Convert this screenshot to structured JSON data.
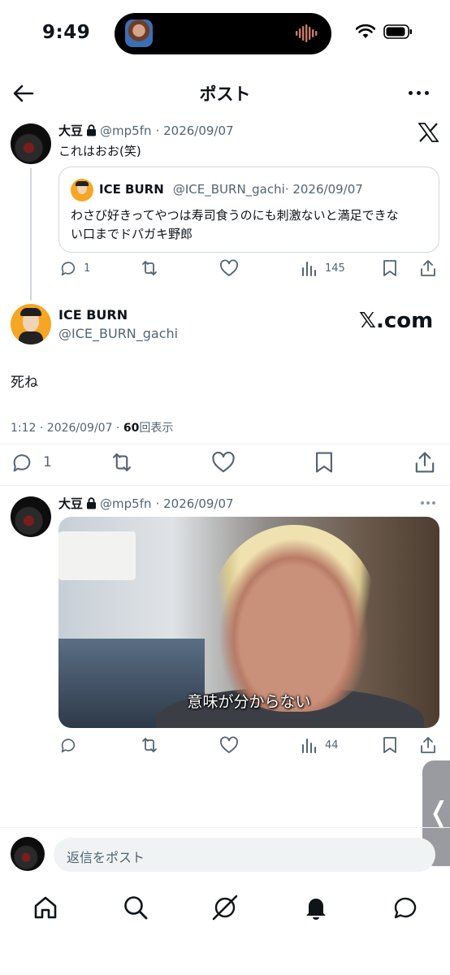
{
  "status_bar": {
    "time": "9:49"
  },
  "header": {
    "title": "ポスト"
  },
  "post1": {
    "name": "大豆",
    "handle": "@mp5fn",
    "date": "· 2026/09/07",
    "text": "これはおお(笑)",
    "quote": {
      "name": "ICE BURN",
      "handle": "@ICE_BURN_gachi",
      "date": "· 2026/09/07",
      "text_line1": "わさび好きってやつは寿司食うのにも刺激ないと満足できな",
      "text_line2": "い口までドパガキ野郎"
    },
    "reply_count": "1",
    "view_count": "145"
  },
  "main_post": {
    "name": "ICE BURN",
    "handle": "@ICE_BURN_gachi",
    "watermark": "𝕏.com",
    "text": "死ね",
    "meta_time": "1:12 · 2026/09/07 · ",
    "views_number": "60",
    "views_label": "回表示",
    "reply_count": "1"
  },
  "post2": {
    "name": "大豆",
    "handle": "@mp5fn",
    "date": "· 2026/09/07",
    "media_caption": "意味が分からない",
    "view_count": "44"
  },
  "reply_bar": {
    "placeholder": "返信をポスト"
  },
  "side_tab": {
    "glyph": "❬"
  },
  "icons": [
    "back-arrow-icon",
    "more-icon",
    "x-logo-icon",
    "lock-icon",
    "reply-icon",
    "repost-icon",
    "like-icon",
    "views-icon",
    "bookmark-icon",
    "share-icon",
    "home-icon",
    "search-icon",
    "grok-icon",
    "bell-icon",
    "messages-icon"
  ]
}
